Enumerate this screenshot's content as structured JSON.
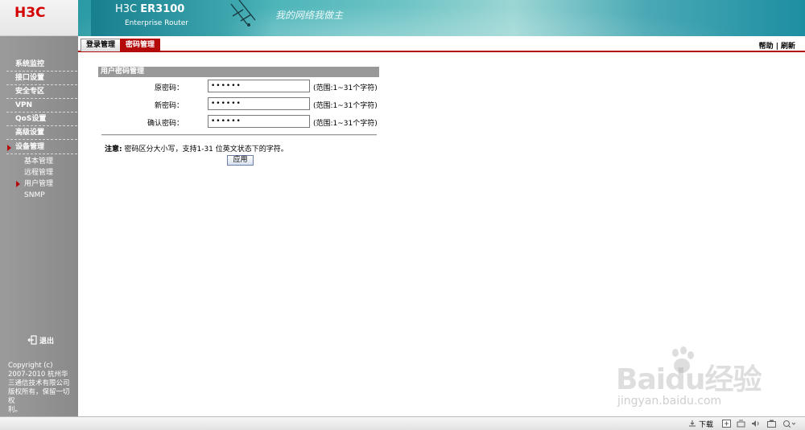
{
  "brand": {
    "logo": "H3C",
    "model_prefix": "H3C",
    "model": "ER3100",
    "subtitle": "Enterprise Router",
    "slogan": "我的网络我做主"
  },
  "tabs": [
    {
      "label": "登录管理",
      "active": false
    },
    {
      "label": "密码管理",
      "active": true
    }
  ],
  "topbar": {
    "help": "帮助",
    "separator": "|",
    "refresh": "刷新"
  },
  "sidebar": {
    "items": [
      {
        "label": "系统监控"
      },
      {
        "label": "接口设置"
      },
      {
        "label": "安全专区"
      },
      {
        "label": "VPN"
      },
      {
        "label": "QoS设置"
      },
      {
        "label": "高级设置"
      },
      {
        "label": "设备管理",
        "active": true
      }
    ],
    "subitems": [
      {
        "label": "基本管理"
      },
      {
        "label": "远程管理"
      },
      {
        "label": "用户管理",
        "active": true
      },
      {
        "label": "SNMP"
      }
    ],
    "logout": "退出",
    "copyright": [
      "Copyright (c)",
      "2007-2010 杭州华",
      "三通信技术有限公司",
      "版权所有，保留一切权",
      "利。"
    ]
  },
  "panel": {
    "title": "用户密码管理",
    "fields": [
      {
        "label": "原密码：",
        "value": "••••••",
        "hint": "(范围:1~31个字符)"
      },
      {
        "label": "新密码：",
        "value": "••••••",
        "hint": "(范围:1~31个字符)"
      },
      {
        "label": "确认密码：",
        "value": "••••••",
        "hint": "(范围:1~31个字符)"
      }
    ],
    "note_label": "注意:",
    "note_text": "密码区分大小写，支持1-31 位英文状态下的字符。",
    "apply_label": "应用"
  },
  "watermark": {
    "main": "Baidu经验",
    "sub": "jingyan.baidu.com"
  },
  "statusbar": {
    "download": "下载"
  },
  "colors": {
    "accent": "#b50a0a",
    "sidebar": "#8f8f8f",
    "banner": "#3aa2ab"
  }
}
